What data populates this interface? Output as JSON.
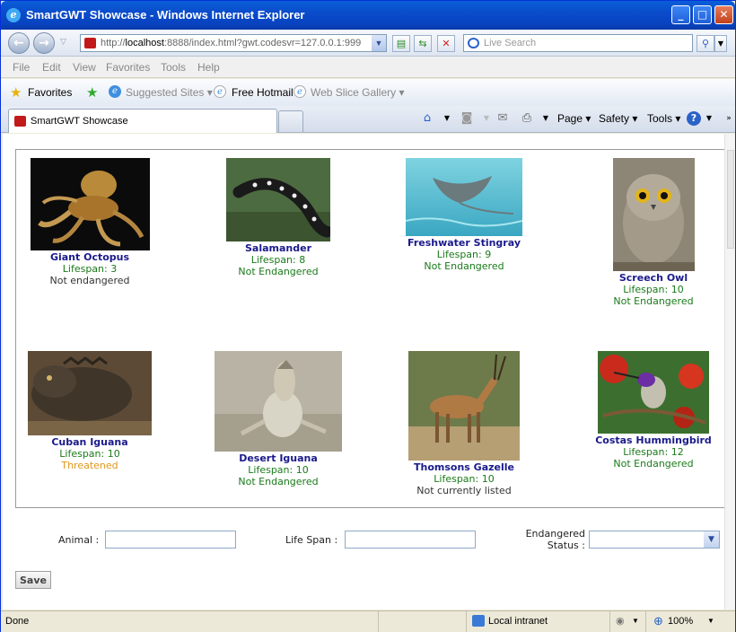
{
  "window": {
    "title": "SmartGWT Showcase - Windows Internet Explorer",
    "minimize": "_",
    "maximize": "□",
    "close": "✕"
  },
  "address": {
    "url_prefix": "http://",
    "url_host": "localhost",
    "url_rest": ":8888/index.html?gwt.codesvr=127.0.0.1:999",
    "search_placeholder": "Live Search"
  },
  "menu": [
    "File",
    "Edit",
    "View",
    "Favorites",
    "Tools",
    "Help"
  ],
  "favorites_bar": {
    "favorites": "Favorites",
    "suggested_sites": "Suggested Sites",
    "free_hotmail": "Free Hotmail",
    "web_slice_gallery": "Web Slice Gallery"
  },
  "tab": {
    "title": "SmartGWT Showcase"
  },
  "command_bar": {
    "page": "Page",
    "safety": "Safety",
    "tools": "Tools"
  },
  "animals": [
    {
      "name": "Giant Octopus",
      "lifespan": "Lifespan: 3",
      "status": "Not endangered",
      "status_color": "#333333"
    },
    {
      "name": "Salamander",
      "lifespan": "Lifespan: 8",
      "status": "Not Endangered",
      "status_color": "#1a7a1a"
    },
    {
      "name": "Freshwater Stingray",
      "lifespan": "Lifespan: 9",
      "status": "Not Endangered",
      "status_color": "#1a7a1a"
    },
    {
      "name": "Screech Owl",
      "lifespan": "Lifespan: 10",
      "status": "Not Endangered",
      "status_color": "#1a7a1a"
    },
    {
      "name": "Cuban Iguana",
      "lifespan": "Lifespan: 10",
      "status": "Threatened",
      "status_color": "#e0961a"
    },
    {
      "name": "Desert Iguana",
      "lifespan": "Lifespan: 10",
      "status": "Not Endangered",
      "status_color": "#1a7a1a"
    },
    {
      "name": "Thomsons Gazelle",
      "lifespan": "Lifespan: 10",
      "status": "Not currently listed",
      "status_color": "#333333"
    },
    {
      "name": "Costas Hummingbird",
      "lifespan": "Lifespan: 12",
      "status": "Not Endangered",
      "status_color": "#1a7a1a"
    }
  ],
  "form": {
    "animal_label": "Animal :",
    "animal_value": "",
    "lifespan_label": "Life Span :",
    "lifespan_value": "",
    "endangered_label_1": "Endangered",
    "endangered_label_2": "Status :",
    "endangered_value": "",
    "save_label": "Save"
  },
  "status_bar": {
    "status": "Done",
    "zone": "Local intranet",
    "zoom": "100%"
  }
}
